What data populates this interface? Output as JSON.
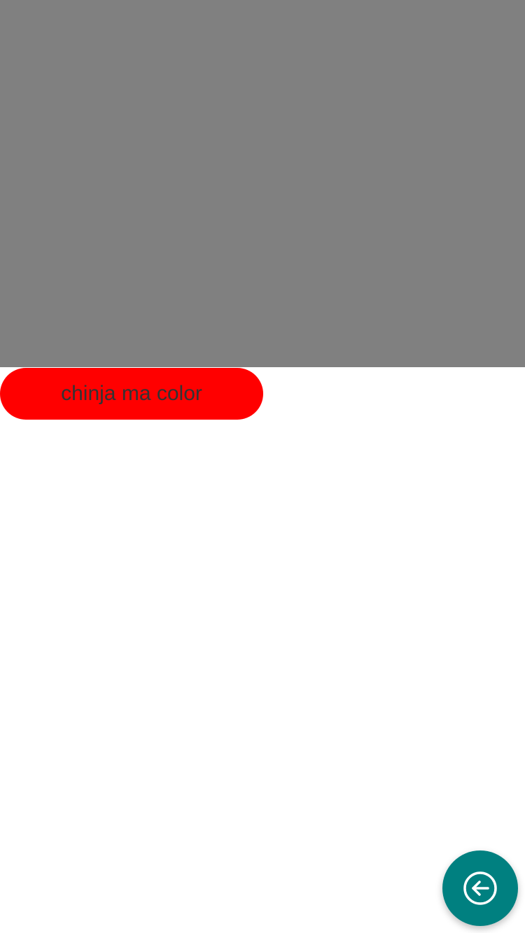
{
  "colors": {
    "preview_background": "#808080",
    "page_background": "#ffffff",
    "button_background": "#ff0000",
    "button_text": "#333333",
    "fab_background": "#008080",
    "fab_icon": "#ffffff"
  },
  "change_color_button": {
    "label": "chinja ma color"
  },
  "fab": {
    "icon": "arrow-left-circle-icon"
  }
}
